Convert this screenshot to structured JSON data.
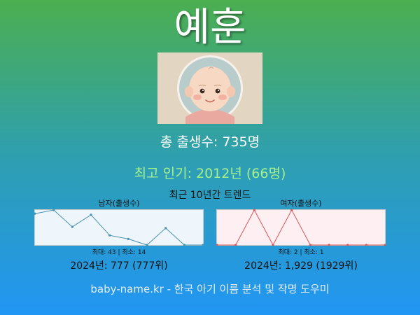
{
  "name": "예훈",
  "total_births": "총 출생수: 735명",
  "most_popular": "최고 인기: 2012년 (66명)",
  "trend_title": "최근 10년간 트렌드",
  "male_chart": {
    "label": "남자(출생수)",
    "stats": "최대: 43 | 최소: 14",
    "latest": "2024년: 777 (777위)"
  },
  "female_chart": {
    "label": "여자(출생수)",
    "stats": "최대: 2 | 최소: 1",
    "latest": "2024년: 1,929 (1929위)"
  },
  "footer": "baby-name.kr - 한국 아기 이름 분석 및 작명 도우미",
  "colors": {
    "male_line": "#4a90b0",
    "male_fill": "#eef6fb",
    "female_line": "#e05555",
    "female_fill": "#fdeff2"
  },
  "chart_data": [
    {
      "type": "line",
      "title": "남자(출생수)",
      "values": [
        40,
        43,
        29,
        39,
        22,
        19,
        14,
        28,
        14,
        14
      ],
      "ylim": [
        14,
        43
      ]
    },
    {
      "type": "line",
      "title": "여자(출생수)",
      "values": [
        1,
        1,
        2,
        1,
        2,
        1,
        1,
        1,
        1,
        1
      ],
      "ylim": [
        1,
        2
      ]
    }
  ]
}
